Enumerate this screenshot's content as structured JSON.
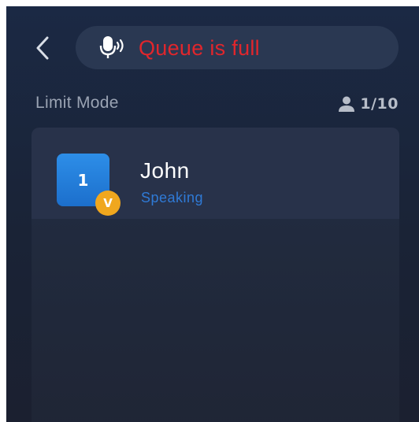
{
  "header": {
    "back_icon": "chevron-left-icon",
    "status_icon": "microphone-speaking-icon",
    "status_text": "Queue is full",
    "status_color": "#e1262c"
  },
  "queue": {
    "mode_label": "Limit Mode",
    "count_icon": "user-icon",
    "count_text": "1/10"
  },
  "speakers": [
    {
      "seat": "1",
      "badge": "V",
      "name": "John",
      "status": "Speaking",
      "avatar_color": "#2a86e2",
      "badge_color": "#f0a71e"
    }
  ]
}
